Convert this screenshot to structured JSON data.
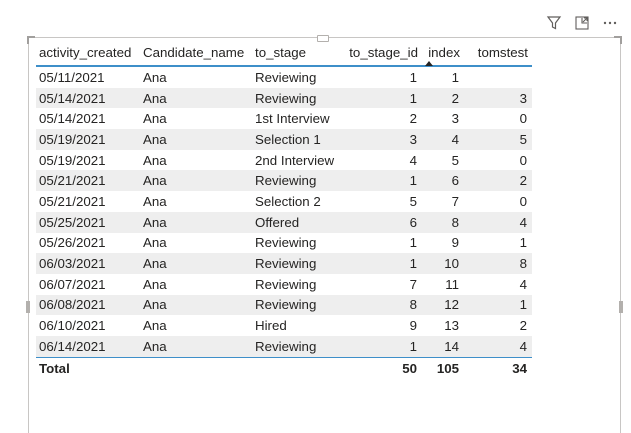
{
  "table": {
    "columns": [
      "activity_created",
      "Candidate_name",
      "to_stage",
      "to_stage_id",
      "index",
      "tomstest"
    ],
    "rows": [
      [
        "05/11/2021",
        "Ana",
        "Reviewing",
        "1",
        "1",
        ""
      ],
      [
        "05/14/2021",
        "Ana",
        "Reviewing",
        "1",
        "2",
        "3"
      ],
      [
        "05/14/2021",
        "Ana",
        "1st Interview",
        "2",
        "3",
        "0"
      ],
      [
        "05/19/2021",
        "Ana",
        "Selection 1",
        "3",
        "4",
        "5"
      ],
      [
        "05/19/2021",
        "Ana",
        "2nd Interview",
        "4",
        "5",
        "0"
      ],
      [
        "05/21/2021",
        "Ana",
        "Reviewing",
        "1",
        "6",
        "2"
      ],
      [
        "05/21/2021",
        "Ana",
        "Selection 2",
        "5",
        "7",
        "0"
      ],
      [
        "05/25/2021",
        "Ana",
        "Offered",
        "6",
        "8",
        "4"
      ],
      [
        "05/26/2021",
        "Ana",
        "Reviewing",
        "1",
        "9",
        "1"
      ],
      [
        "06/03/2021",
        "Ana",
        "Reviewing",
        "1",
        "10",
        "8"
      ],
      [
        "06/07/2021",
        "Ana",
        "Reviewing",
        "7",
        "11",
        "4"
      ],
      [
        "06/08/2021",
        "Ana",
        "Reviewing",
        "8",
        "12",
        "1"
      ],
      [
        "06/10/2021",
        "Ana",
        "Hired",
        "9",
        "13",
        "2"
      ],
      [
        "06/14/2021",
        "Ana",
        "Reviewing",
        "1",
        "14",
        "4"
      ]
    ],
    "total": {
      "label": "Total",
      "to_stage_id": "50",
      "index": "105",
      "tomstest": "34"
    }
  },
  "icons": [
    "filter-icon",
    "focus-mode-icon",
    "more-options-icon"
  ],
  "colors": {
    "accent": "#3e8fc9",
    "stripe": "#eeeeee"
  }
}
